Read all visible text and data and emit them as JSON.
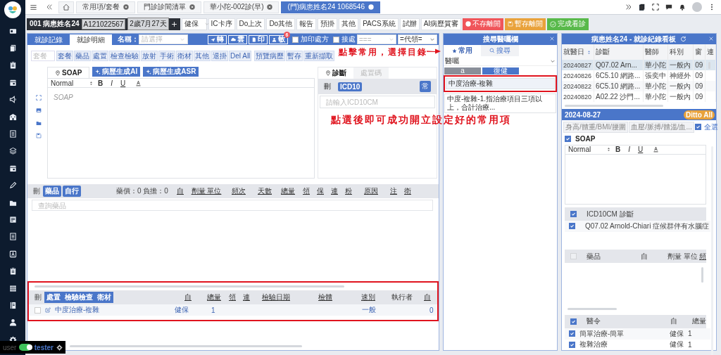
{
  "top_tabs": [
    {
      "label": "常用項/套餐",
      "selected": false
    },
    {
      "label": "門診診間清單",
      "selected": false
    },
    {
      "label": "華小陀-002診(早)",
      "selected": false
    },
    {
      "label": "(門)病患姓名24 1068546",
      "selected": true
    }
  ],
  "patient_bar": {
    "name": "001 病患姓名24",
    "id_badge": "A121022567",
    "age_badge": "2歲7月27天",
    "insurance": "健保",
    "buttons": [
      {
        "label": "IC卡序",
        "kind": "plain"
      },
      {
        "label": "Do上次",
        "kind": "plain"
      },
      {
        "label": "Do其他",
        "kind": "plain"
      },
      {
        "label": "報告",
        "kind": "plain"
      },
      {
        "label": "預掛",
        "kind": "plain"
      },
      {
        "label": "其他",
        "kind": "plain"
      },
      {
        "label": "PACS系統",
        "kind": "plain"
      },
      {
        "label": "試辦",
        "kind": "plain"
      },
      {
        "label": "AI病歷質審",
        "kind": "plain"
      },
      {
        "label": "不存離開",
        "kind": "danger"
      },
      {
        "label": "暫存離開",
        "kind": "warning"
      },
      {
        "label": "完成看診",
        "kind": "success"
      }
    ]
  },
  "main": {
    "tabs": [
      {
        "label": "就診記錄",
        "selected": false
      },
      {
        "label": "就診明細",
        "selected": true
      }
    ],
    "name_label": "名稱：",
    "name_placeholder": "請選擇",
    "action_buttons": [
      {
        "label": "轉",
        "kind": "send"
      },
      {
        "label": "雲",
        "kind": "cloud"
      },
      {
        "label": "印",
        "kind": "print"
      },
      {
        "label": "敏",
        "kind": "user",
        "badge": "6"
      }
    ],
    "checks": [
      {
        "label": "加印處方",
        "checked": false
      },
      {
        "label": "接處",
        "checked": false
      }
    ],
    "selects": [
      "===",
      "=代領="
    ],
    "package_placeholder": "套餐",
    "toolbar_buttons": [
      "套餐",
      "藥品",
      "處置",
      "檢查檢驗",
      "放射",
      "手術",
      "衛材",
      "其他",
      "退掛",
      "Del All",
      "預覽病歷",
      "暫存",
      "重新擷取"
    ],
    "soap_tab": "SOAP",
    "ai_buttons": [
      "病歷生成AI",
      "病歷生成ASR"
    ],
    "editor": {
      "format": "Normal",
      "format_buttons": [
        "B",
        "I",
        "U"
      ],
      "placeholder": "SOAP"
    },
    "diag_tabs": [
      {
        "label": "診斷",
        "selected": true
      },
      {
        "label": "處置碼",
        "selected": false
      }
    ],
    "diag_header": {
      "delete": "刪",
      "code_badge": "ICD10",
      "common_button": "常"
    },
    "diag_placeholder": "請輸入ICD10CM",
    "drug_table": {
      "delete": "刪",
      "badges": [
        "藥品",
        "自行"
      ],
      "summary": "藥價：0 負擔：0",
      "columns": [
        "自",
        "劑量 單位",
        "頻次",
        "天數",
        "總量",
        "領",
        "保",
        "連",
        "粉",
        "原因",
        "注",
        "衛"
      ],
      "search_placeholder": "查詢藥品"
    },
    "order_table": {
      "delete": "刪",
      "badges": [
        "處置",
        "檢驗檢查",
        "衛材"
      ],
      "columns": [
        "自",
        "總量",
        "領",
        "連",
        "檢驗日期",
        "檢體",
        "速別",
        "執行者",
        "自"
      ],
      "rows": [
        {
          "checked": false,
          "name": "中度治療-複雜",
          "self": "健保",
          "total": "1",
          "speed": "一般",
          "copay": "0"
        }
      ]
    }
  },
  "search_panel": {
    "title": "搜尋醫囑欄",
    "tabs": [
      {
        "label": "常用",
        "selected": true
      },
      {
        "label": "搜尋",
        "selected": false
      }
    ],
    "category": "醫囑",
    "subtabs": [
      {
        "label": "a",
        "selected": false
      },
      {
        "label": "復健",
        "selected": true
      }
    ],
    "items": [
      "中度治療-複雜",
      "中度-複雜-1.指治療項目三項以上，合計治療..."
    ]
  },
  "history_panel": {
    "title": "病患姓名24 - 就診紀錄看板",
    "columns": [
      "就醫日",
      "診斷",
      "醫師",
      "科別",
      "窗",
      "連"
    ],
    "rows": [
      {
        "date": "20240827",
        "diagnosis": "Q07.02 Arn...",
        "doctor": "華小陀",
        "dept": "一般內",
        "window": "09",
        "selected": true
      },
      {
        "date": "20240826",
        "diagnosis": "6C5.10 網路...",
        "doctor": "張奕中",
        "dept": "神經外",
        "window": "09",
        "selected": false
      },
      {
        "date": "20240822",
        "diagnosis": "6C5.10 網路...",
        "doctor": "華小陀",
        "dept": "一般內",
        "window": "09",
        "selected": false
      },
      {
        "date": "20240820",
        "diagnosis": "A02.22 沙門...",
        "doctor": "華小陀",
        "dept": "一般內",
        "window": "09",
        "selected": false
      }
    ],
    "date": "2024-08-27",
    "ditto": "Ditto All",
    "vital_tabs": [
      "身高/體重/BMI/腰圍",
      "血壓/脈搏/體溫/血..."
    ],
    "select_all": {
      "label": "全選",
      "checked": true
    },
    "soap": {
      "label": "SOAP",
      "checked": true
    },
    "editor_format": "Normal",
    "format_buttons": [
      "B",
      "I",
      "U"
    ],
    "icd": {
      "label": "ICD10CM 診斷",
      "checked": true,
      "items": [
        {
          "label": "Q07.02 Arnold-Chiari 症候群伴有水腦症",
          "checked": true
        }
      ]
    },
    "drugs": {
      "checked": false,
      "columns": [
        "藥品",
        "自",
        "劑量 單位",
        "頻"
      ]
    },
    "orders": {
      "checked": true,
      "columns": [
        "醫令",
        "自",
        "總量"
      ],
      "rows": [
        {
          "checked": true,
          "name": "簡單治療-簡單",
          "self": "健保",
          "total": "1"
        },
        {
          "checked": true,
          "name": "複雜治療",
          "self": "健保",
          "total": "1"
        }
      ]
    }
  },
  "user_badge": {
    "user": "user",
    "on": true,
    "name": "tester"
  },
  "annotations": [
    "點擊常用，選擇目錄",
    "點選後即可成功開立設定好的常用項"
  ]
}
